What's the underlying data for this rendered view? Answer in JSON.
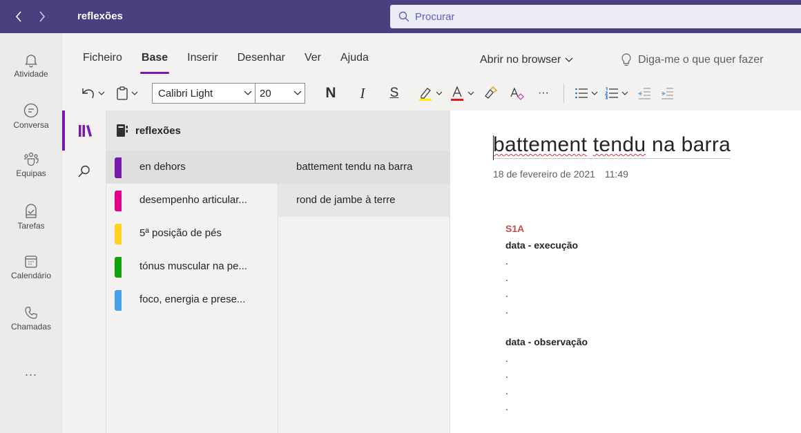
{
  "topbar": {
    "title": "reflexões",
    "search_placeholder": "Procurar"
  },
  "rail": {
    "items": [
      {
        "label": "Atividade",
        "icon": "bell-icon"
      },
      {
        "label": "Conversa",
        "icon": "chat-icon"
      },
      {
        "label": "Equipas",
        "icon": "teams-icon"
      },
      {
        "label": "Tarefas",
        "icon": "tasks-icon"
      },
      {
        "label": "Calendário",
        "icon": "calendar-icon"
      },
      {
        "label": "Chamadas",
        "icon": "phone-icon"
      }
    ],
    "more": "..."
  },
  "ribbon": {
    "tabs": [
      "Ficheiro",
      "Base",
      "Inserir",
      "Desenhar",
      "Ver",
      "Ajuda"
    ],
    "active_tab": "Base",
    "open_browser": "Abrir no browser",
    "tell_me": "Diga-me o que quer fazer",
    "font": "Calibri Light",
    "size": "20",
    "bold": "N",
    "italic": "I",
    "underline": "S",
    "more": "···"
  },
  "notebook": {
    "name": "reflexões",
    "sections": [
      {
        "label": "en dehors",
        "color": "#7719aa"
      },
      {
        "label": "desempenho articular...",
        "color": "#e3008c"
      },
      {
        "label": "5ª posição de pés",
        "color": "#ffd21f"
      },
      {
        "label": "tónus muscular na pe...",
        "color": "#13a10e"
      },
      {
        "label": "foco, energia e prese...",
        "color": "#4aa0e6"
      }
    ],
    "pages": [
      "battement tendu na barra",
      "rond de jambe à terre"
    ]
  },
  "page": {
    "title_word1": "battement",
    "title_word2": "tendu",
    "title_rest": " na barra",
    "date": "18 de fevereiro de 2021",
    "time": "11:49",
    "tag": "S1A",
    "heading1": "data - execução",
    "heading2": "data - observação",
    "dot": "."
  },
  "colors": {
    "topbar": "#4b3f80",
    "accent": "#7719aa",
    "tag_red": "#c0504d"
  }
}
